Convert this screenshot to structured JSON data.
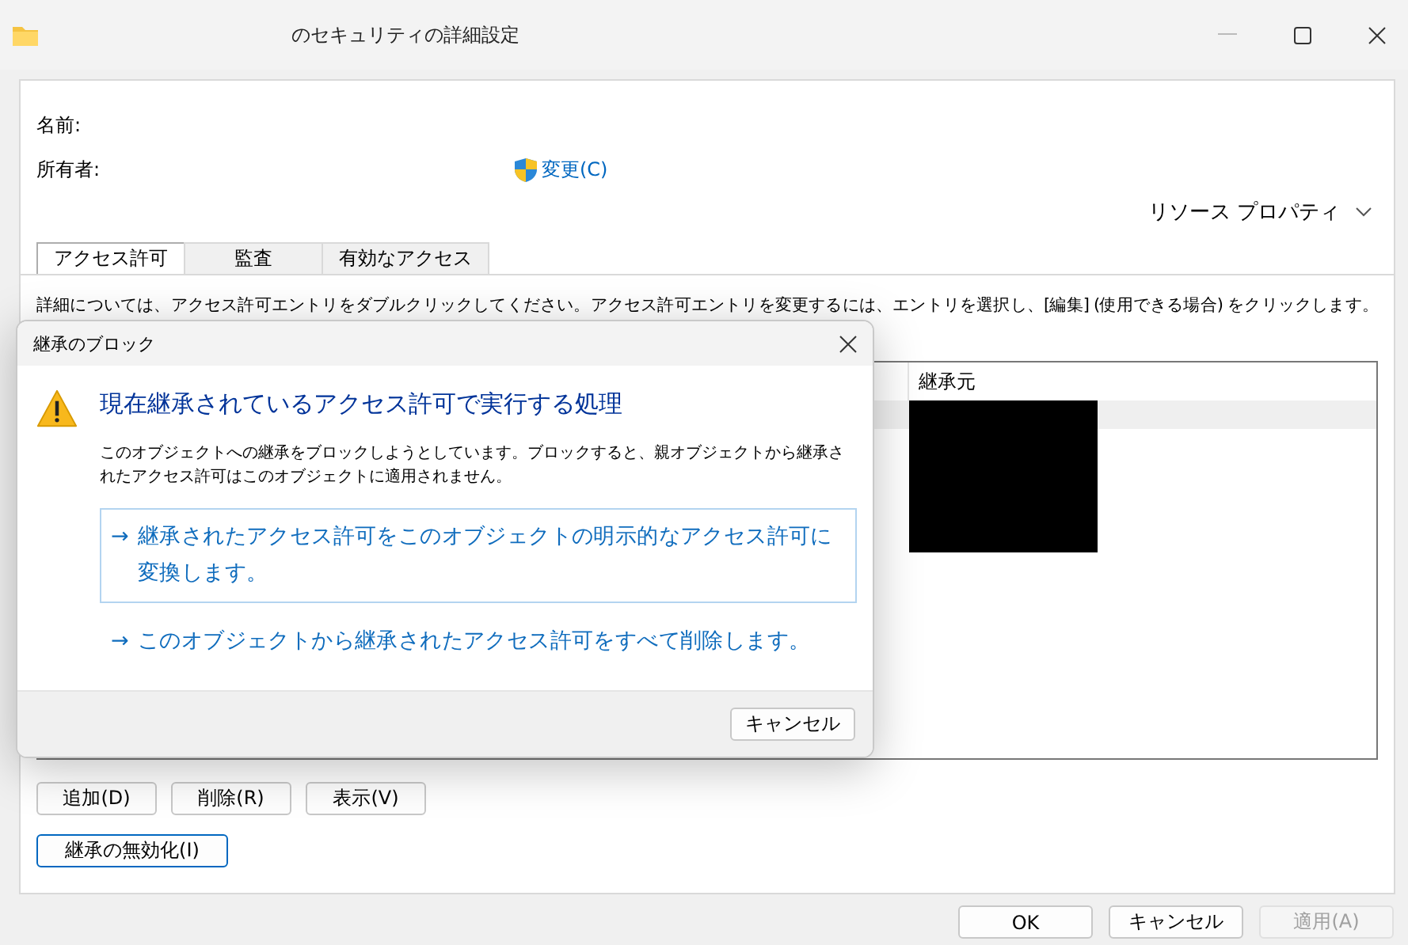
{
  "window": {
    "title": "のセキュリティの詳細設定"
  },
  "name_label": "名前:",
  "owner_label": "所有者:",
  "owner_change_link": "変更(C)",
  "resource_properties": "リソース プロパティ",
  "tabs": [
    {
      "label": "アクセス許可",
      "selected": true
    },
    {
      "label": "監査",
      "selected": false
    },
    {
      "label": "有効なアクセス",
      "selected": false
    }
  ],
  "description": "詳細については、アクセス許可エントリをダブルクリックしてください。アクセス許可エントリを変更するには、エントリを選択し、[編集] (使用できる場合) をクリックします。",
  "table": {
    "columns": [
      {
        "label": "継承元"
      }
    ],
    "rows": [
      {
        "selected": true
      }
    ]
  },
  "entry_buttons": [
    "追加(D)",
    "削除(R)",
    "表示(V)"
  ],
  "disable_inheritance_button": {
    "label": "継承の無効化(I)",
    "focused": true
  },
  "footer_buttons": [
    {
      "label": "OK",
      "disabled": false
    },
    {
      "label": "キャンセル",
      "disabled": false
    },
    {
      "label": "適用(A)",
      "disabled": true
    }
  ],
  "dialog": {
    "title": "継承のブロック",
    "heading": "現在継承されているアクセス許可で実行する処理",
    "body": "このオブジェクトへの継承をブロックしようとしています。ブロックすると、親オブジェクトから継承されたアクセス許可はこのオブジェクトに適用されません。",
    "options": [
      {
        "arrow": "→",
        "label": "継承されたアクセス許可をこのオブジェクトの明示的なアクセス許可に変換します。",
        "highlighted": true
      },
      {
        "arrow": "→",
        "label": "このオブジェクトから継承されたアクセス許可をすべて削除します。",
        "highlighted": false
      }
    ],
    "cancel_button": "キャンセル"
  }
}
